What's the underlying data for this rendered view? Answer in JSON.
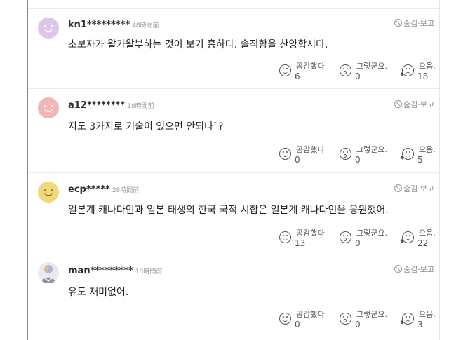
{
  "report_label": "숨김·보고",
  "reaction_labels": {
    "like": "공감했다",
    "ok": "그렇군요.",
    "hmm": "으음."
  },
  "comments": [
    {
      "user": "kn1*********",
      "time": "48時間前",
      "text": "초보자가 왈가왈부하는 것이 보기 흉하다. 솔직함을 찬양합시다.",
      "avatar_color": "#dcc6ec",
      "counts": {
        "like": "6",
        "ok": "0",
        "hmm": "18"
      }
    },
    {
      "user": "a12********",
      "time": "18時間前",
      "text": "지도 3가지로 기술이 있으면 안되나˜?",
      "avatar_color": "#f2b6b3",
      "counts": {
        "like": "0",
        "ok": "0",
        "hmm": "5"
      }
    },
    {
      "user": "ecp*****",
      "time": "28時間前",
      "text": "일본계 캐나다인과 일본 태생의 한국 국적 시합은 일본계 캐나다인을 응원했어.",
      "avatar_color": "#efd97a",
      "counts": {
        "like": "13",
        "ok": "0",
        "hmm": "22"
      }
    },
    {
      "user": "man*********",
      "time": "18時間前",
      "text": "유도 재미없어.",
      "avatar_color": "#e9eaef",
      "counts": {
        "like": "0",
        "ok": "0",
        "hmm": "3"
      }
    }
  ]
}
